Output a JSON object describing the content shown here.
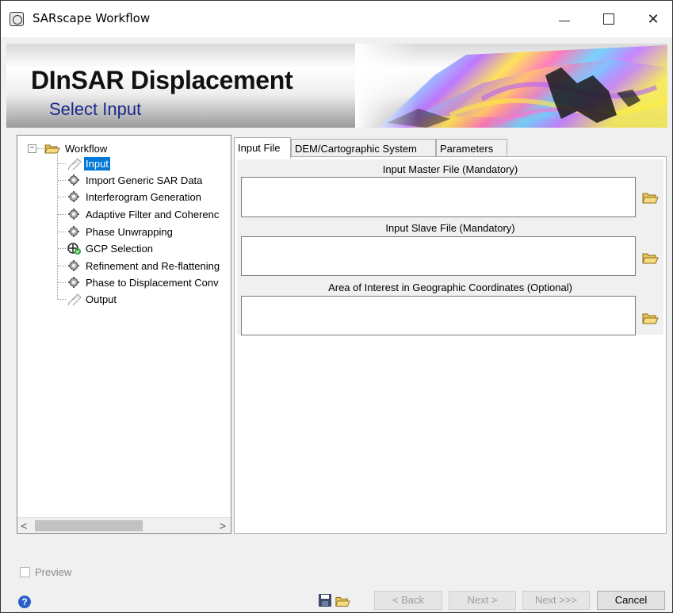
{
  "window": {
    "title": "SARscape Workflow",
    "controls": {
      "minimize": "—",
      "maximize": "☐",
      "close": "✕"
    }
  },
  "header": {
    "title": "DInSAR Displacement",
    "subtitle": "Select Input"
  },
  "tree": {
    "root_label": "Workflow",
    "expander": "⊟",
    "items": [
      {
        "label": "Input",
        "icon": "pencil-icon",
        "selected": true
      },
      {
        "label": "Import Generic SAR Data",
        "icon": "gear-icon"
      },
      {
        "label": "Interferogram Generation",
        "icon": "gear-icon"
      },
      {
        "label": "Adaptive Filter and Coherenc",
        "icon": "gear-icon"
      },
      {
        "label": "Phase Unwrapping",
        "icon": "gear-icon"
      },
      {
        "label": "GCP Selection",
        "icon": "crosshair-check-icon"
      },
      {
        "label": "Refinement and Re-flattening",
        "icon": "gear-icon"
      },
      {
        "label": "Phase to Displacement Conv",
        "icon": "gear-icon"
      },
      {
        "label": "Output",
        "icon": "pencil-icon"
      }
    ],
    "scroll_left": "<",
    "scroll_right": ">"
  },
  "tabs": [
    {
      "label": "Input File",
      "active": true
    },
    {
      "label": "DEM/Cartographic System",
      "active": false
    },
    {
      "label": "Parameters",
      "active": false
    }
  ],
  "input_file": {
    "master_label": "Input Master File (Mandatory)",
    "master_value": "",
    "slave_label": "Input Slave File (Mandatory)",
    "slave_value": "",
    "aoi_label": "Area of Interest in Geographic Coordinates (Optional)",
    "aoi_value": ""
  },
  "footer": {
    "preview_label": "Preview",
    "preview_checked": false,
    "help": "?",
    "back_label": "< Back",
    "next_label": "Next >",
    "next_all_label": "Next >>>",
    "cancel_label": "Cancel"
  },
  "colors": {
    "selection": "#0078d7",
    "subtitle": "#1a2a8a",
    "folder": "#e8c25a"
  }
}
